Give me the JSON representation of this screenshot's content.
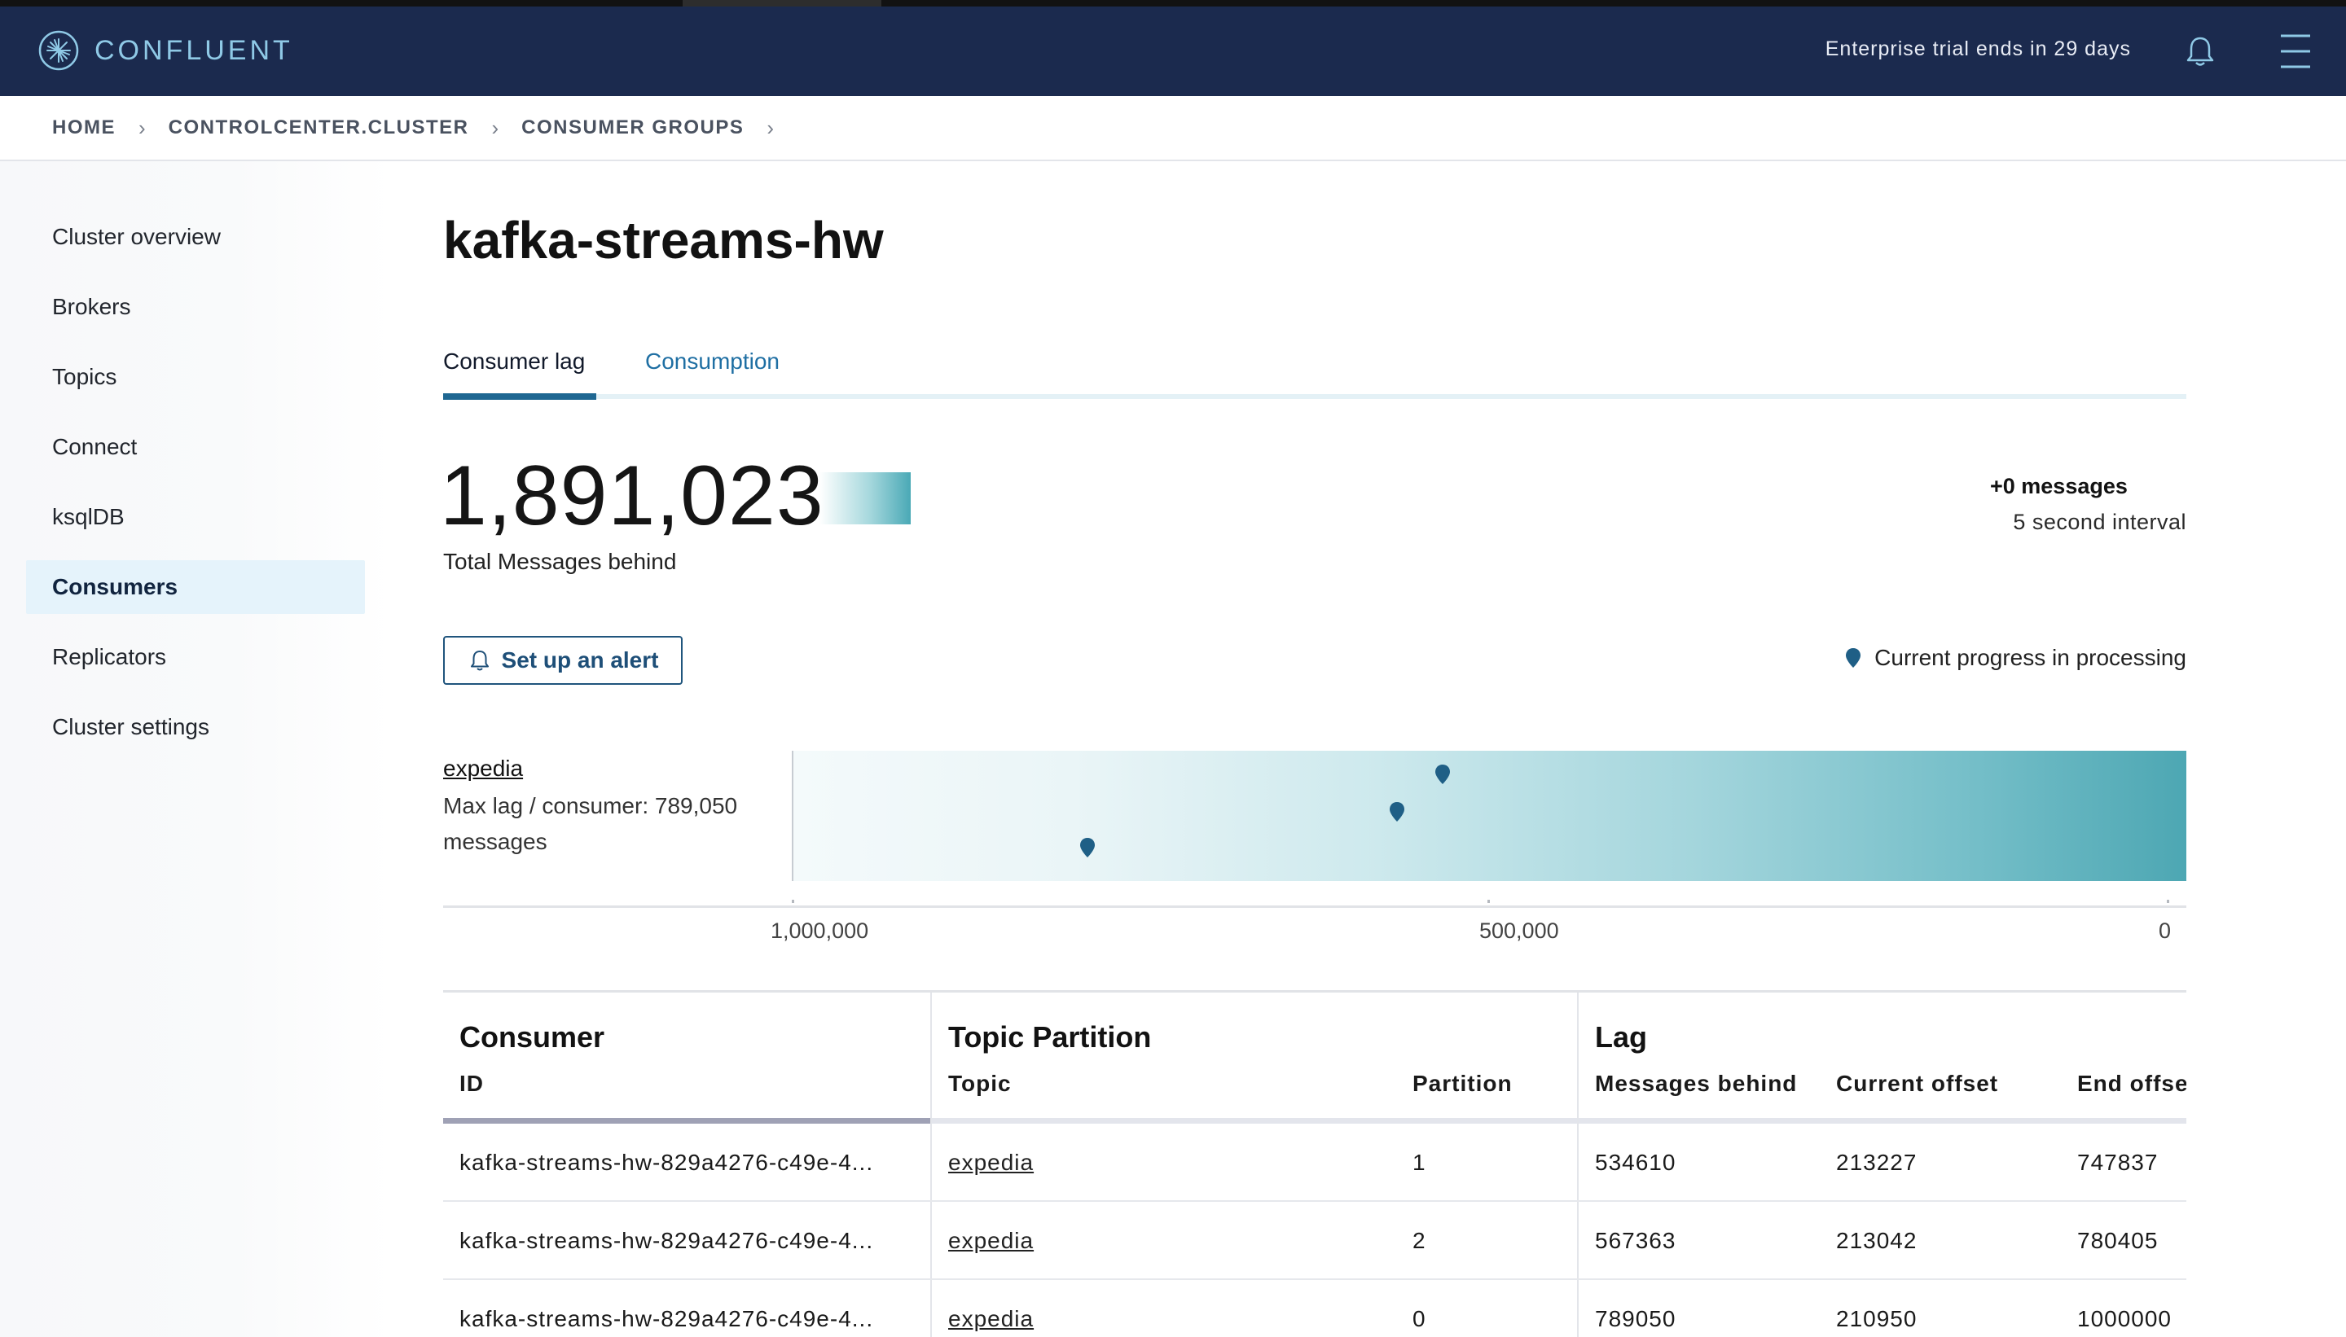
{
  "header": {
    "brand": "CONFLUENT",
    "trial_notice": "Enterprise trial ends in 29 days"
  },
  "breadcrumb": [
    "HOME",
    "CONTROLCENTER.CLUSTER",
    "CONSUMER GROUPS"
  ],
  "sidebar": {
    "items": [
      {
        "label": "Cluster overview",
        "active": false
      },
      {
        "label": "Brokers",
        "active": false
      },
      {
        "label": "Topics",
        "active": false
      },
      {
        "label": "Connect",
        "active": false
      },
      {
        "label": "ksqlDB",
        "active": false
      },
      {
        "label": "Consumers",
        "active": true
      },
      {
        "label": "Replicators",
        "active": false
      },
      {
        "label": "Cluster settings",
        "active": false
      }
    ]
  },
  "page": {
    "title": "kafka-streams-hw",
    "tabs": [
      {
        "label": "Consumer lag",
        "active": true
      },
      {
        "label": "Consumption",
        "active": false
      }
    ]
  },
  "summary": {
    "total_behind": "1,891,023",
    "total_behind_caption": "Total Messages behind",
    "delta": "+0 messages",
    "interval": "5 second interval"
  },
  "actions": {
    "alert_button": "Set up an alert"
  },
  "legend": {
    "label": "Current progress in processing"
  },
  "lag_chart": {
    "group_link": "expedia",
    "max_lag_text": "Max lag / consumer: 789,050 messages",
    "axis_labels": [
      "1,000,000",
      "500,000",
      "0"
    ],
    "axis_max": 1000000,
    "consumer_lags": [
      534610,
      567363,
      789050
    ]
  },
  "table": {
    "groups": [
      "Consumer",
      "Topic Partition",
      "Lag"
    ],
    "columns": [
      "ID",
      "Topic",
      "Partition",
      "Messages behind",
      "Current offset",
      "End offse"
    ],
    "rows": [
      [
        "kafka-streams-hw-829a4276-c49e-4...",
        "expedia",
        "1",
        "534610",
        "213227",
        "747837"
      ],
      [
        "kafka-streams-hw-829a4276-c49e-4...",
        "expedia",
        "2",
        "567363",
        "213042",
        "780405"
      ],
      [
        "kafka-streams-hw-829a4276-c49e-4...",
        "expedia",
        "0",
        "789050",
        "210950",
        "1000000"
      ]
    ]
  },
  "colors": {
    "header_bg": "#1b2a4e",
    "brand": "#8fc9e6",
    "accent": "#1f6792",
    "pin": "#1f5f86"
  },
  "icons": [
    "confluent-logo-icon",
    "bell-icon",
    "hamburger-menu-icon",
    "chevron-right-icon",
    "location-pin-icon"
  ]
}
